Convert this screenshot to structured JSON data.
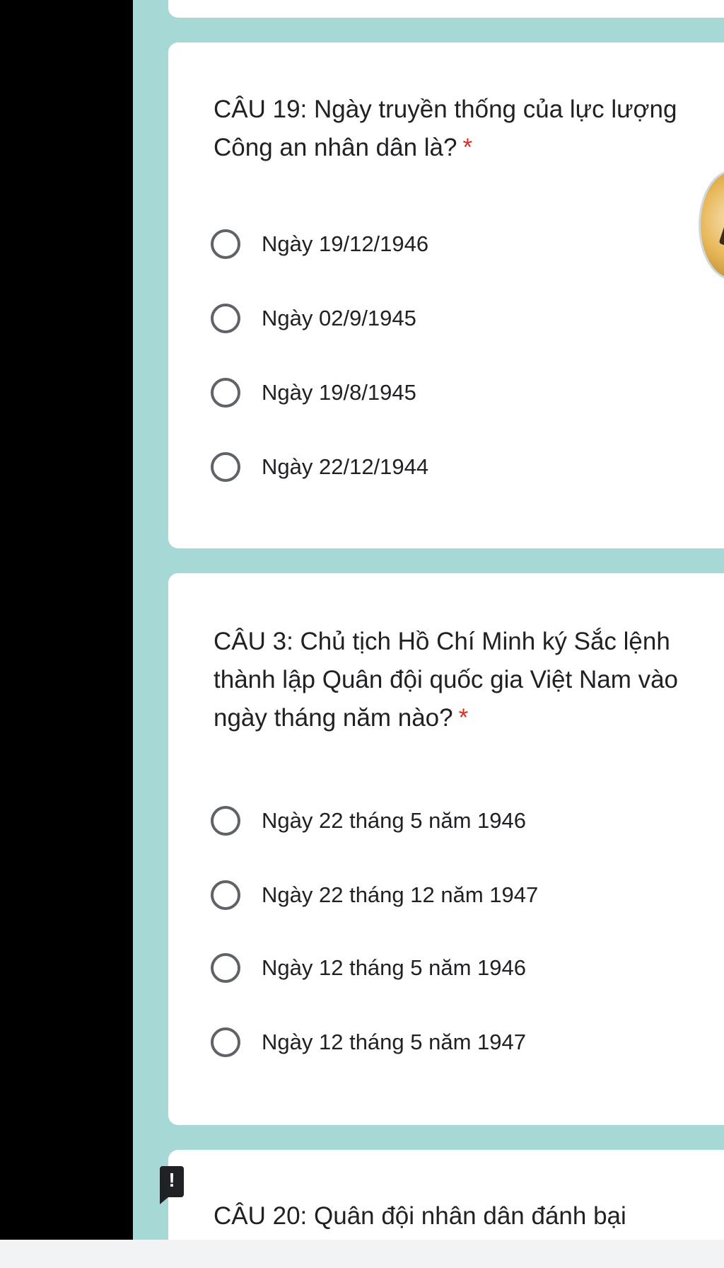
{
  "questions": [
    {
      "text": "CÂU 19: Ngày truyền thống của lực lượng Công an nhân dân là?",
      "required_mark": "*",
      "options": [
        "Ngày 19/12/1946",
        "Ngày 02/9/1945",
        "Ngày 19/8/1945",
        "Ngày 22/12/1944"
      ]
    },
    {
      "text": "CÂU 3: Chủ tịch Hồ Chí Minh ký Sắc lệnh thành lập Quân đội quốc gia Việt Nam vào ngày tháng năm nào?",
      "required_mark": "*",
      "options": [
        "Ngày 22 tháng 5 năm 1946",
        "Ngày 22 tháng 12 năm 1947",
        "Ngày 12 tháng 5 năm 1946",
        "Ngày 12 tháng 5 năm 1947"
      ]
    },
    {
      "text": "CÂU 20: Quân đội nhân dân đánh bại"
    }
  ],
  "alert_icon": {
    "name": "exclamation-icon",
    "glyph": "!"
  },
  "colors": {
    "background": "#a6d9d5",
    "card": "#ffffff",
    "required": "#d93025",
    "text": "#202124"
  }
}
